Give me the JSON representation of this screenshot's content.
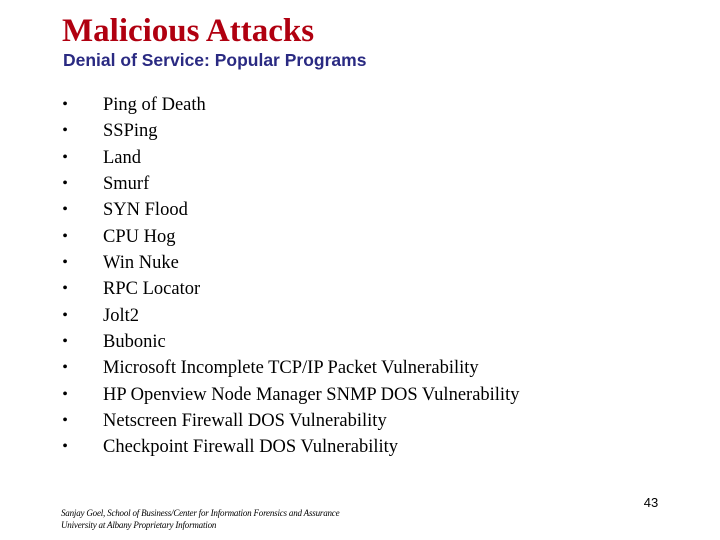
{
  "slide": {
    "title": "Malicious Attacks",
    "subtitle": "Denial of Service: Popular Programs",
    "colors": {
      "title": "#B00010",
      "subtitle": "#2A2A82",
      "body": "#000000",
      "background": "#FFFFFF"
    },
    "bullet_icon": "bullet-dot",
    "bullet_glyph": "•",
    "items": [
      "Ping of Death",
      "SSPing",
      "Land",
      "Smurf",
      "SYN Flood",
      "CPU Hog",
      "Win Nuke",
      "RPC Locator",
      "Jolt2",
      "Bubonic",
      "Microsoft Incomplete TCP/IP Packet Vulnerability",
      "HP Openview Node Manager SNMP DOS Vulnerability",
      "Netscreen Firewall DOS Vulnerability",
      "Checkpoint Firewall DOS Vulnerability"
    ],
    "footer": {
      "line1": "Sanjay Goel, School of Business/Center for Information Forensics and Assurance",
      "line2": "University at Albany Proprietary Information"
    },
    "page_number": "43"
  }
}
